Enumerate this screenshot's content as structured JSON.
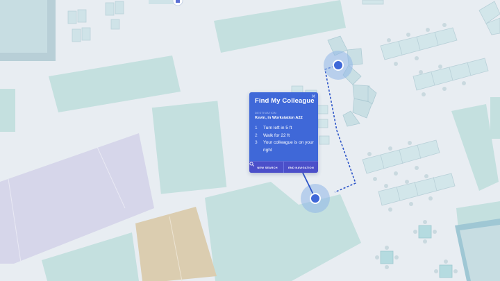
{
  "map": {
    "title": "Find My Colleague",
    "colors": {
      "background": "#e8edf2",
      "building_teal": "#bfdcdb",
      "building_lavender": "#d6d6ea",
      "building_tan": "#d9ccb0",
      "accent_blue": "#3f68d8",
      "footer_indigo": "#4b4fc9",
      "route": "#2d55c8"
    }
  },
  "panel": {
    "title": "Find My Colleague",
    "destination_label": "DESTINATION",
    "destination": "Kevin, in Workstation A22",
    "steps": [
      {
        "n": "1",
        "text": "Turn left in 5 ft"
      },
      {
        "n": "2",
        "text": "Walk for 22 ft"
      },
      {
        "n": "3",
        "text": "Your colleague is on your right"
      }
    ],
    "buttons": {
      "new_search": "NEW SEARCH",
      "end_navigation": "END NAVIGATION"
    },
    "icons": {
      "search": "search-icon",
      "close": "close-icon"
    }
  }
}
